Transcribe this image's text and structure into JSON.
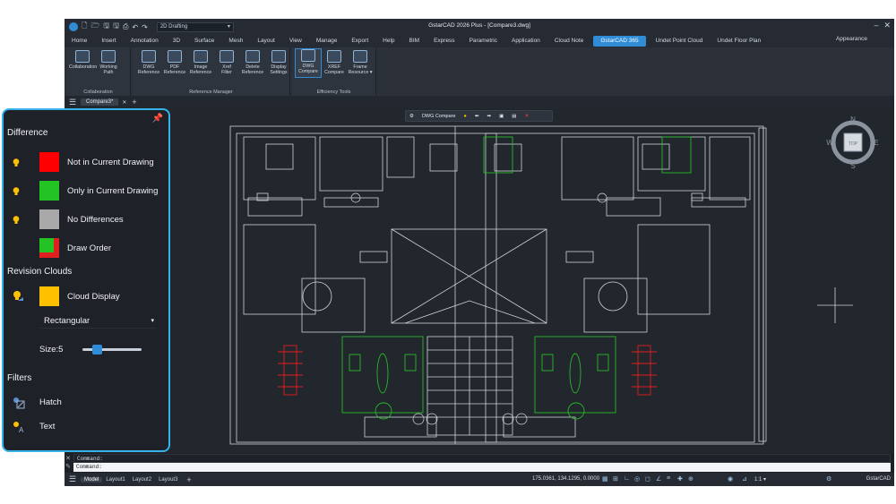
{
  "window": {
    "title": "GstarCAD 2026 Plus - [Compare3.dwg]",
    "workspace": "2D Drafting",
    "appearance": "Appearance"
  },
  "ribbon_tabs": [
    "Home",
    "Insert",
    "Annotation",
    "3D",
    "Surface",
    "Mesh",
    "Layout",
    "View",
    "Manage",
    "Export",
    "Help",
    "BIM",
    "Express",
    "Parametric",
    "Application",
    "Cloud Note",
    "GstarCAD 365",
    "Undet Point Cloud",
    "Undet Floor Plan"
  ],
  "active_tab_index": 16,
  "ribbon": {
    "panels": [
      {
        "title": "Collaboration",
        "buttons": [
          {
            "l1": "Collaboration",
            "l2": ""
          },
          {
            "l1": "Working",
            "l2": "Path"
          }
        ]
      },
      {
        "title": "Reference Manager",
        "buttons": [
          {
            "l1": "DWG",
            "l2": "Reference"
          },
          {
            "l1": "PDF",
            "l2": "Reference"
          },
          {
            "l1": "Image",
            "l2": "Reference"
          },
          {
            "l1": "Xref",
            "l2": "Filter"
          },
          {
            "l1": "Delete",
            "l2": "Reference"
          },
          {
            "l1": "Display",
            "l2": "Settings"
          }
        ]
      },
      {
        "title": "Efficiency Tools",
        "buttons": [
          {
            "l1": "DWG",
            "l2": "Compare"
          },
          {
            "l1": "XREF",
            "l2": "Compare"
          },
          {
            "l1": "Frame",
            "l2": "Resource ▾"
          }
        ]
      }
    ]
  },
  "document_tab": "Compare3*",
  "compare_toolbar": {
    "label": "DWG Compare"
  },
  "compass": {
    "n": "N",
    "s": "S",
    "e": "E",
    "w": "W",
    "top": "TOP"
  },
  "compare_panel": {
    "difference_title": "Difference",
    "items": [
      {
        "label": "Not in Current Drawing",
        "color": "#ff0000"
      },
      {
        "label": "Only in Current Drawing",
        "color": "#22c322"
      },
      {
        "label": "No Differences",
        "color": "#a8a8a8"
      },
      {
        "label": "Draw Order",
        "color": "#22c322"
      }
    ],
    "revision_title": "Revision Clouds",
    "cloud_label": "Cloud Display",
    "cloud_color": "#ffc000",
    "shape": "Rectangular",
    "size_label": "Size:5",
    "size_value": 5,
    "size_fraction": 0.2,
    "filters_title": "Filters",
    "filters": [
      "Hatch",
      "Text"
    ]
  },
  "command": {
    "line1": "Command:",
    "line2": "Command:"
  },
  "status": {
    "layouts": [
      "Model",
      "Layout1",
      "Layout2",
      "Layout3"
    ],
    "coords": "175.0361, 134.1295, 0.0000",
    "scale": "1:1 ▾",
    "brand": "GstarCAD"
  }
}
